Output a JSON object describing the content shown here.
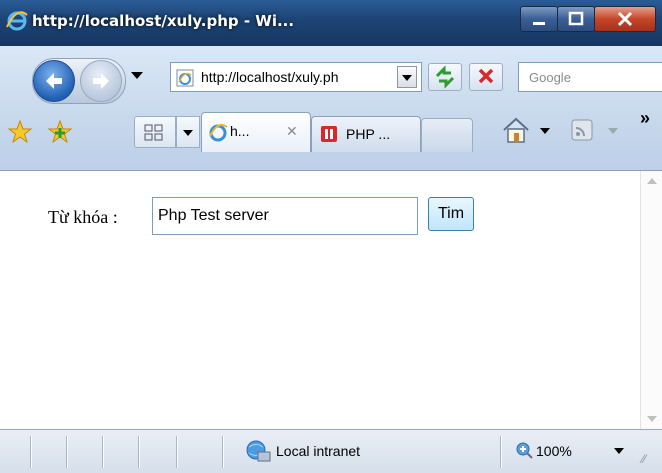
{
  "window": {
    "title": "http://localhost/xuly.php - Wi..."
  },
  "toolbar": {
    "address": "http://localhost/xuly.ph",
    "search_placeholder": "Google"
  },
  "tabs": [
    {
      "label": "h...",
      "close": "✕"
    },
    {
      "label": "PHP ..."
    }
  ],
  "more_chevron": "»",
  "page": {
    "search_label": "Từ khóa :",
    "search_value": "Php Test server",
    "search_button": "Tim"
  },
  "statusbar": {
    "zone": "Local intranet",
    "zoom": "100%"
  },
  "colors": {
    "titlebar": "#1e4577",
    "chrome": "#c7d8ec",
    "button_accent": "#bee6fd"
  }
}
